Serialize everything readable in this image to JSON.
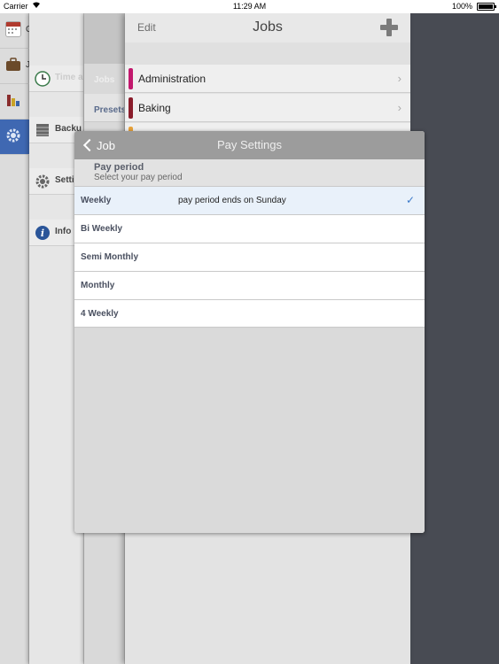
{
  "status_bar": {
    "carrier": "Carrier",
    "time": "11:29 AM",
    "battery": "100%",
    "battery_fraction": 1.0
  },
  "root_menu": {
    "items": [
      {
        "icon": "calendar-icon",
        "label": "C",
        "color": "#b03a2e"
      },
      {
        "icon": "briefcase-icon",
        "label": "J",
        "color": "#6b4a2a"
      },
      {
        "icon": "chart-icon",
        "label": "",
        "color": "#8a2d2d"
      },
      {
        "icon": "gear-icon",
        "label": "",
        "color": "#3f68b2",
        "active": true
      }
    ]
  },
  "settings_menu": {
    "items": [
      {
        "icon": "clock-icon",
        "label": "Time a"
      },
      {
        "icon": "backup-icon",
        "label": "Backu"
      },
      {
        "icon": "gear-icon",
        "label": "Setti"
      },
      {
        "icon": "info-icon",
        "label": "Info"
      }
    ]
  },
  "jobs_menu": {
    "items": [
      "Jobs",
      "Presets"
    ]
  },
  "jobs_panel": {
    "edit_label": "Edit",
    "title": "Jobs",
    "rows": [
      {
        "name": "Administration",
        "color": "#c2186d"
      },
      {
        "name": "Baking",
        "color": "#8a1c2b"
      },
      {
        "name": "",
        "color": "#e8a23a"
      }
    ]
  },
  "pay_settings": {
    "back_label": "Job",
    "title": "Pay Settings",
    "section_header": "Pay period",
    "section_subtitle": "Select your pay period",
    "options": [
      {
        "name": "Weekly",
        "desc": "pay period ends on Sunday",
        "selected": true,
        "check": "✓"
      },
      {
        "name": "Bi Weekly",
        "desc": "",
        "selected": false
      },
      {
        "name": "Semi Monthly",
        "desc": "",
        "selected": false
      },
      {
        "name": "Monthly",
        "desc": "",
        "selected": false
      },
      {
        "name": "4 Weekly",
        "desc": "",
        "selected": false
      }
    ]
  }
}
